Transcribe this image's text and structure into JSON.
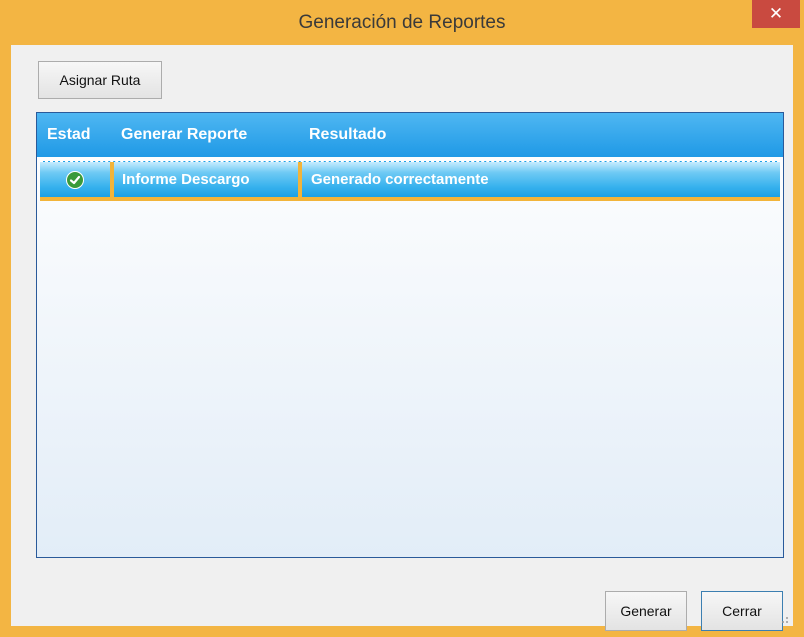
{
  "window": {
    "title": "Generación de Reportes"
  },
  "toolbar": {
    "assign_label": "Asignar Ruta"
  },
  "grid": {
    "columns": [
      "Estad",
      "Generar Reporte",
      "Resultado"
    ],
    "rows": [
      {
        "status": "check-icon",
        "report": "Informe Descargo",
        "result": "Generado correctamente"
      }
    ]
  },
  "footer": {
    "generate_label": "Generar",
    "close_label": "Cerrar"
  },
  "colors": {
    "frame": "#f3b543",
    "header": "#2aa3ec",
    "row_highlight": "#38b2ee",
    "close_button": "#c94a40"
  }
}
